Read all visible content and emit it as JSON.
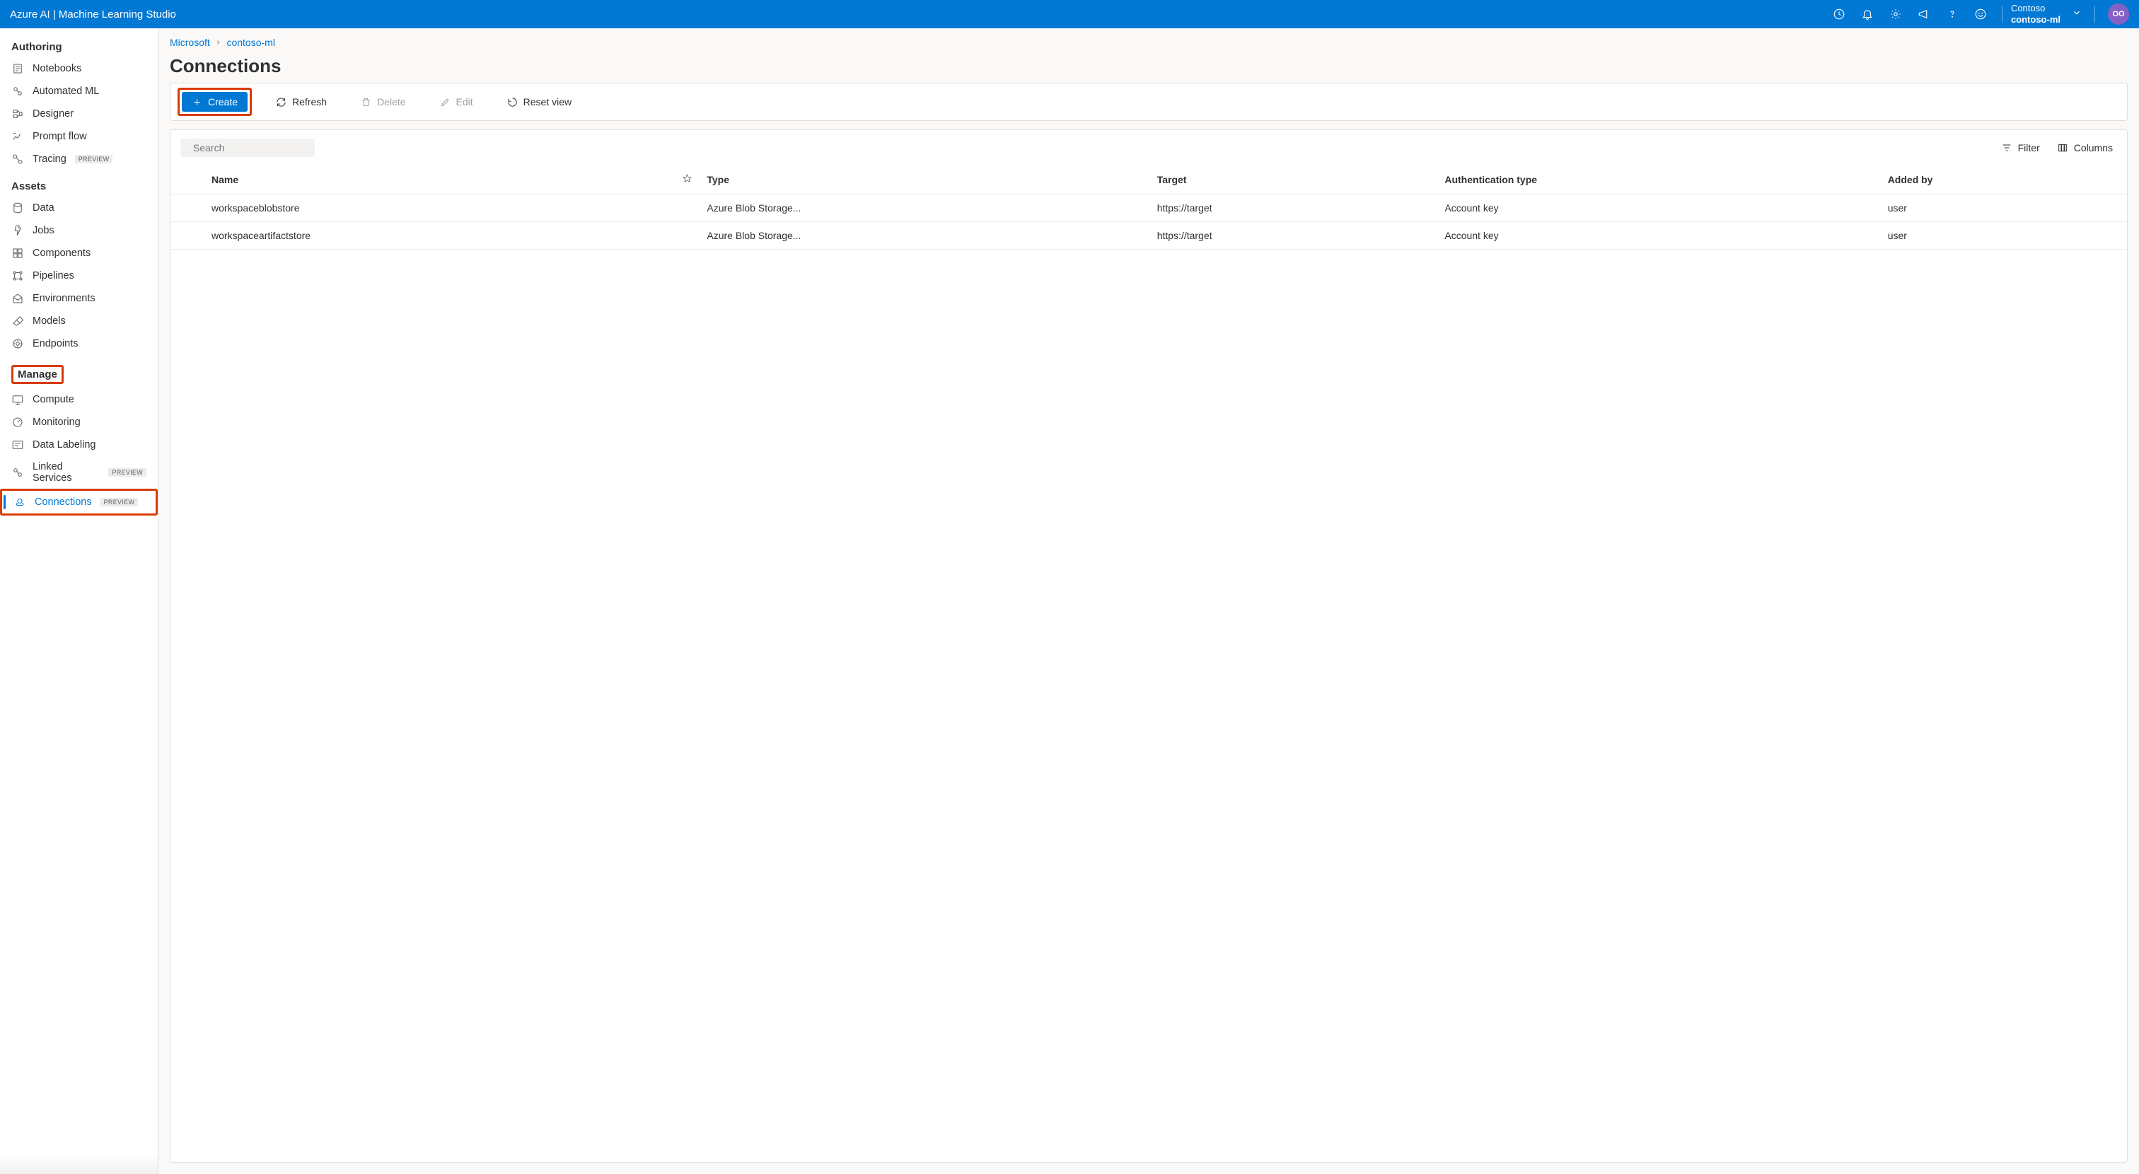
{
  "topbar": {
    "title": "Azure AI | Machine Learning Studio",
    "org": "Contoso",
    "workspace": "contoso-ml",
    "avatar_initials": "OO"
  },
  "breadcrumb": {
    "items": [
      "Microsoft",
      "contoso-ml"
    ]
  },
  "page": {
    "title": "Connections"
  },
  "toolbar": {
    "create": "Create",
    "refresh": "Refresh",
    "delete": "Delete",
    "edit": "Edit",
    "reset": "Reset view"
  },
  "panel": {
    "search_placeholder": "Search",
    "filter": "Filter",
    "columns_btn": "Columns",
    "headers": {
      "name": "Name",
      "type": "Type",
      "target": "Target",
      "auth": "Authentication type",
      "added_by": "Added by"
    },
    "rows": [
      {
        "name": "workspaceblobstore",
        "type": "Azure Blob Storage...",
        "target": "https://target",
        "auth": "Account key",
        "added_by": "user"
      },
      {
        "name": "workspaceartifactstore",
        "type": "Azure Blob Storage...",
        "target": "https://target",
        "auth": "Account key",
        "added_by": "user"
      }
    ]
  },
  "sidebar": {
    "preview_label": "PREVIEW",
    "sections": [
      {
        "title": "Authoring",
        "items": [
          {
            "label": "Notebooks"
          },
          {
            "label": "Automated ML"
          },
          {
            "label": "Designer"
          },
          {
            "label": "Prompt flow"
          },
          {
            "label": "Tracing",
            "preview": true
          }
        ]
      },
      {
        "title": "Assets",
        "items": [
          {
            "label": "Data"
          },
          {
            "label": "Jobs"
          },
          {
            "label": "Components"
          },
          {
            "label": "Pipelines"
          },
          {
            "label": "Environments"
          },
          {
            "label": "Models"
          },
          {
            "label": "Endpoints"
          }
        ]
      },
      {
        "title": "Manage",
        "title_highlight": true,
        "items": [
          {
            "label": "Compute"
          },
          {
            "label": "Monitoring"
          },
          {
            "label": "Data Labeling"
          },
          {
            "label": "Linked Services",
            "preview": true
          },
          {
            "label": "Connections",
            "preview": true,
            "selected": true,
            "highlight": true
          }
        ]
      }
    ]
  }
}
